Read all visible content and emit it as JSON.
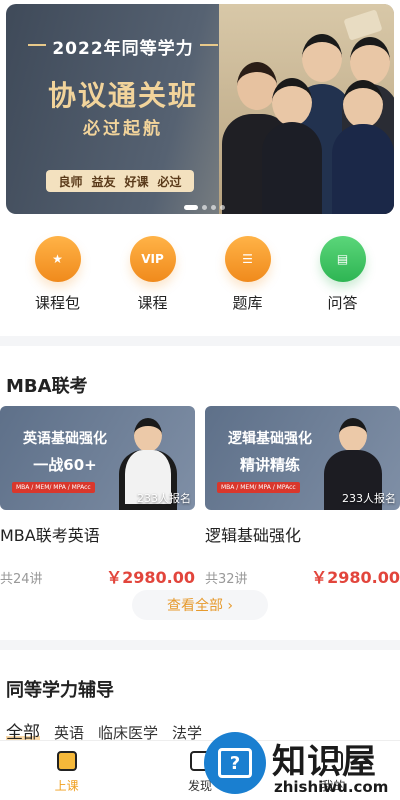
{
  "banner": {
    "year_line": "2022年同等学力",
    "title": "协议通关班",
    "subtitle": "必过起航",
    "tags": [
      "良师",
      "益友",
      "好课",
      "必过"
    ]
  },
  "quick_nav": [
    {
      "label": "课程包",
      "icon": "ticket-icon"
    },
    {
      "label": "课程",
      "icon": "vip-icon"
    },
    {
      "label": "题库",
      "icon": "document-icon"
    },
    {
      "label": "问答",
      "icon": "chat-icon"
    }
  ],
  "mba_section": {
    "title": "MBA联考",
    "courses": [
      {
        "thumb_line1": "英语基础强化",
        "thumb_line2": "一战60+",
        "thumb_tag": "MBA / MEM/ MPA / MPAcc",
        "enroll": "233人报名",
        "name": "MBA联考英语",
        "lessons": "共24讲",
        "price": "￥2980.00"
      },
      {
        "thumb_line1": "逻辑基础强化",
        "thumb_line2": "精讲精练",
        "thumb_tag": "MBA / MEM/ MPA / MPAcc",
        "enroll": "233人报名",
        "name": "逻辑基础强化",
        "lessons": "共32讲",
        "price": "￥2980.00"
      }
    ],
    "view_all": "查看全部 ›"
  },
  "tutoring_section": {
    "title": "同等学力辅导",
    "tabs": [
      "全部",
      "英语",
      "临床医学",
      "法学"
    ]
  },
  "bottom_nav": [
    {
      "label": "上课",
      "active": true
    },
    {
      "label": "发现",
      "active": false
    },
    {
      "label": "我的",
      "active": false
    }
  ],
  "watermark": {
    "name": "知识屋",
    "domain": "zhishiwu.com",
    "badge": "?"
  },
  "colors": {
    "accent_orange": "#f08a1c",
    "price_red": "#e2453c",
    "green": "#2eb553"
  }
}
